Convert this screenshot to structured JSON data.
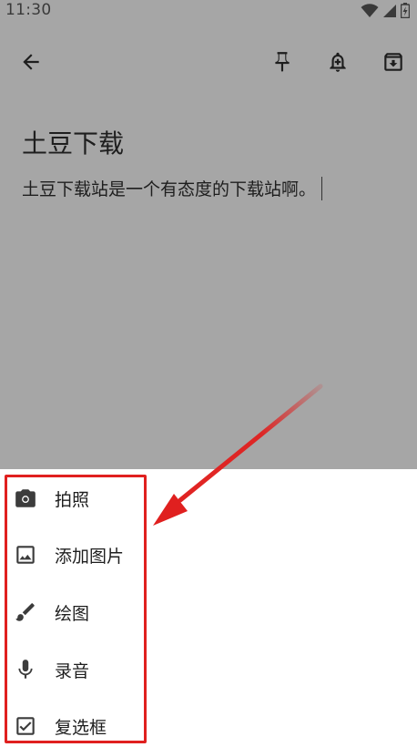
{
  "status_bar": {
    "time": "11:30",
    "wifi_icon": "wifi-icon",
    "signal_icon": "signal-icon",
    "battery_icon": "battery-icon"
  },
  "toolbar": {
    "back_icon": "arrow-back-icon",
    "pin_icon": "pin-icon",
    "reminder_icon": "add-reminder-icon",
    "archive_icon": "archive-icon"
  },
  "note": {
    "title": "土豆下载",
    "body": "土豆下载站是一个有态度的下载站啊。"
  },
  "add_menu": {
    "items": [
      {
        "label": "拍照",
        "icon": "camera-icon"
      },
      {
        "label": "添加图片",
        "icon": "image-icon"
      },
      {
        "label": "绘图",
        "icon": "brush-icon"
      },
      {
        "label": "录音",
        "icon": "microphone-icon"
      },
      {
        "label": "复选框",
        "icon": "checkbox-icon"
      }
    ]
  },
  "annotation": {
    "highlight_color": "#e0201f",
    "arrow_color": "#e0201f"
  },
  "colors": {
    "scrim": "#a6a6a6",
    "sheet": "#ffffff",
    "text": "#1e1e1e",
    "icon": "#3c3c3c"
  }
}
